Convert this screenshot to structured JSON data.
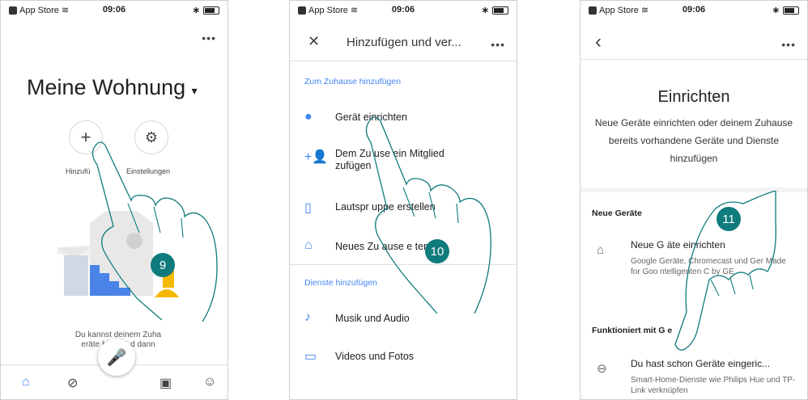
{
  "status": {
    "carrier": "App Store",
    "time": "09:06"
  },
  "screen1": {
    "title": "Meine Wohnung",
    "add_label": "Hinzufü",
    "settings_label": "Einstellungen",
    "bottom_text": "Du kannst deinem Zuha          eräte hinzufü            d dann",
    "step": "9"
  },
  "screen2": {
    "title": "Hinzufügen und ver...",
    "section1": "Zum Zuhause hinzufügen",
    "items1": [
      {
        "label": "Gerät einrichten",
        "icon": "add-circle-icon"
      },
      {
        "label": "Dem Zu   use ein Mitglied   zufügen",
        "icon": "add-person-icon"
      },
      {
        "label": "Lautspr          uppe erstellen",
        "icon": "speaker-icon"
      },
      {
        "label": "Neues Zu   ause e   ten",
        "icon": "home-icon"
      }
    ],
    "section2": "Dienste hinzufügen",
    "items2": [
      {
        "label": "Musik und Audio",
        "icon": "music-icon"
      },
      {
        "label": "Videos und Fotos",
        "icon": "tv-icon"
      }
    ],
    "step": "10"
  },
  "screen3": {
    "title": "Einrichten",
    "description": "Neue Geräte einrichten oder deinem Zuhause bereits vorhandene Geräte und Dienste hinzufügen",
    "section1": "Neue Geräte",
    "item1_title": "Neue G    äte einrichten",
    "item1_sub": "Google         Geräte, Chromecast und Ger              Made for Goo         ntelligenten C by GE",
    "section2": "Funktioniert mit G      e",
    "item2_title": "Du hast schon Geräte eingeric...",
    "item2_sub": "Smart-Home-Dienste wie Philips Hue und TP-Link verknüpfen",
    "step": "11"
  },
  "colors": {
    "accent": "#4285f4",
    "badge": "#0f7b7c",
    "hand": "#0f7b7c"
  }
}
